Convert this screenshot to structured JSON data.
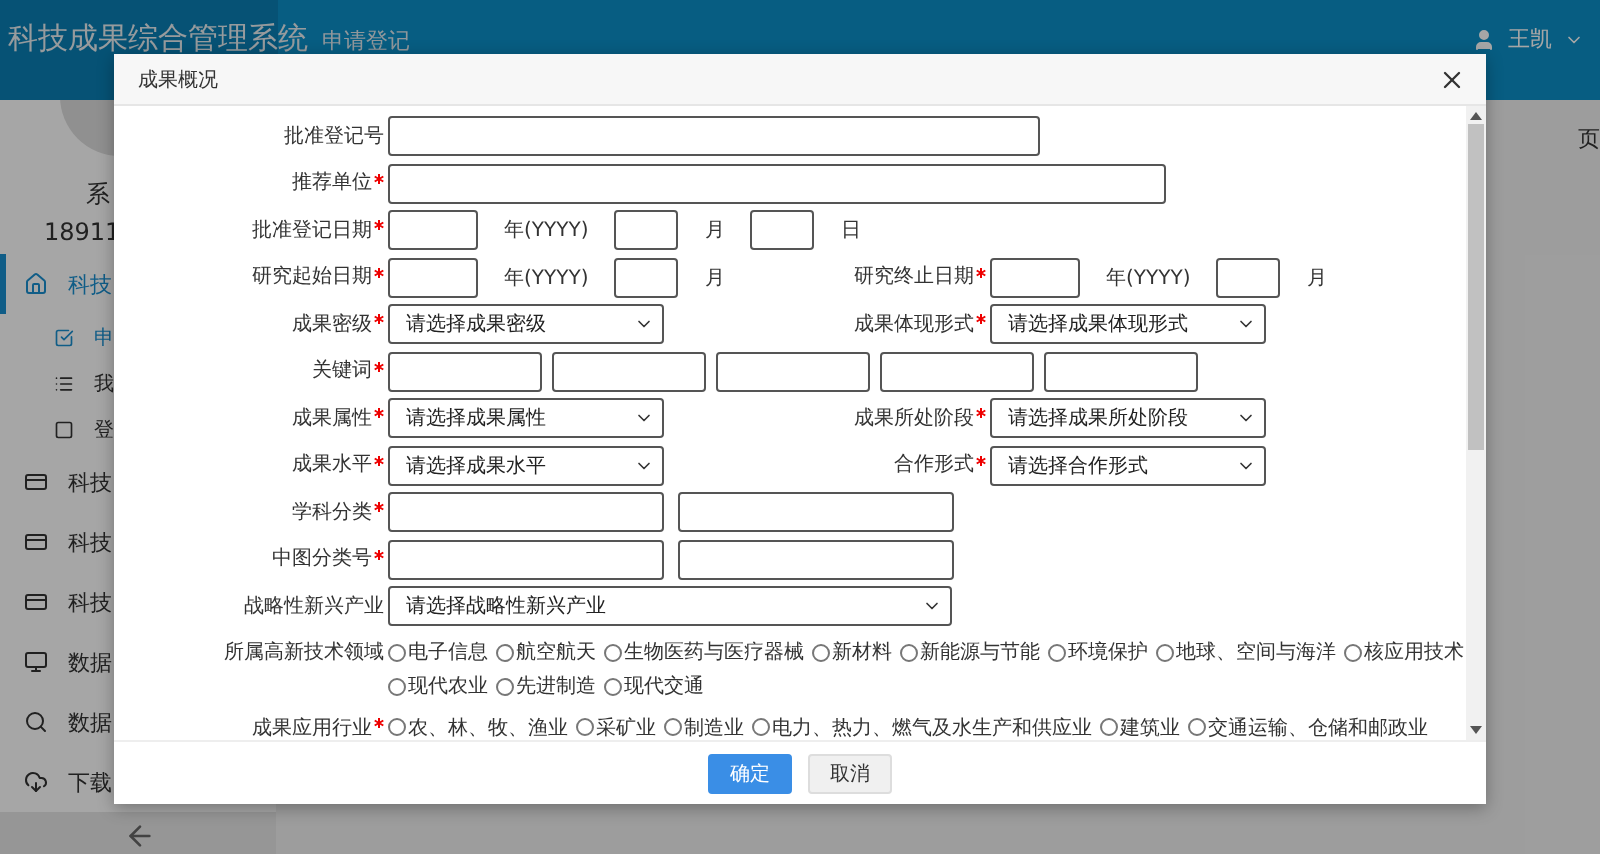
{
  "header": {
    "title": "科技成果综合管理系统",
    "nav_item": "申请登记",
    "user": "王凯"
  },
  "sidebar": {
    "user_name": "系",
    "phone": "18911",
    "items": [
      {
        "label": "科技",
        "selected": true,
        "children": [
          {
            "label": "申",
            "selected": true
          },
          {
            "label": "我",
            "selected": false
          },
          {
            "label": "登",
            "selected": false
          }
        ]
      },
      {
        "label": "科技",
        "selected": false
      },
      {
        "label": "科技",
        "selected": false
      },
      {
        "label": "科技",
        "selected": false
      },
      {
        "label": "数据",
        "selected": false
      },
      {
        "label": "数据",
        "selected": false
      },
      {
        "label": "下载",
        "selected": false
      }
    ]
  },
  "main": {
    "tab_fragment": "页"
  },
  "dialog": {
    "title": "成果概况",
    "rows": [
      {
        "cells": [
          {
            "label": "批准登记号",
            "required": false,
            "controls": [
              {
                "kind": "id-text"
              }
            ]
          }
        ]
      },
      {
        "cells": [
          {
            "label": "推荐单位",
            "required": true,
            "controls": [
              {
                "kind": "org-text"
              }
            ]
          }
        ]
      },
      {
        "cells": [
          {
            "label": "批准登记日期",
            "required": true,
            "controls": [
              {
                "kind": "year",
                "unit": "年(YYYY)"
              },
              {
                "kind": "month",
                "unit": "月"
              },
              {
                "kind": "day",
                "unit": "日"
              }
            ]
          }
        ]
      },
      {
        "cells": [
          {
            "label": "研究起始日期",
            "required": true,
            "controls": [
              {
                "kind": "year",
                "unit": "年(YYYY)"
              },
              {
                "kind": "month",
                "unit": "月"
              }
            ]
          },
          {
            "label": "研究终止日期",
            "required": true,
            "controls": [
              {
                "kind": "year",
                "unit": "年(YYYY)"
              },
              {
                "kind": "month",
                "unit": "月"
              }
            ]
          }
        ]
      },
      {
        "cells": [
          {
            "label": "成果密级",
            "required": true,
            "controls": [
              {
                "kind": "select",
                "placeholder": "请选择成果密级"
              }
            ]
          },
          {
            "label": "成果体现形式",
            "required": true,
            "controls": [
              {
                "kind": "select",
                "placeholder": "请选择成果体现形式"
              }
            ]
          }
        ]
      },
      {
        "cells": [
          {
            "label": "关键词",
            "required": true,
            "controls": [
              {
                "kind": "keyword"
              },
              {
                "kind": "keyword"
              },
              {
                "kind": "keyword"
              },
              {
                "kind": "keyword"
              },
              {
                "kind": "keyword"
              }
            ]
          }
        ]
      },
      {
        "cells": [
          {
            "label": "成果属性",
            "required": true,
            "controls": [
              {
                "kind": "select",
                "placeholder": "请选择成果属性"
              }
            ]
          },
          {
            "label": "成果所处阶段",
            "required": true,
            "controls": [
              {
                "kind": "select",
                "placeholder": "请选择成果所处阶段"
              }
            ]
          }
        ]
      },
      {
        "cells": [
          {
            "label": "成果水平",
            "required": true,
            "controls": [
              {
                "kind": "select",
                "placeholder": "请选择成果水平"
              }
            ]
          },
          {
            "label": "合作形式",
            "required": true,
            "controls": [
              {
                "kind": "select",
                "placeholder": "请选择合作形式"
              }
            ]
          }
        ]
      },
      {
        "cells": [
          {
            "label": "学科分类",
            "required": true,
            "controls": [
              {
                "kind": "code"
              },
              {
                "kind": "code"
              }
            ]
          }
        ]
      },
      {
        "cells": [
          {
            "label": "中图分类号",
            "required": true,
            "controls": [
              {
                "kind": "code"
              },
              {
                "kind": "code"
              }
            ]
          }
        ]
      },
      {
        "cells": [
          {
            "label": "战略性新兴产业",
            "required": false,
            "controls": [
              {
                "kind": "wide-select",
                "placeholder": "请选择战略性新兴产业"
              }
            ]
          }
        ]
      },
      {
        "cells": [
          {
            "label": "所属高新技术领域",
            "required": false,
            "controls": [
              {
                "kind": "radios",
                "options": [
                  {
                    "label": "电子信息",
                    "selected": false
                  },
                  {
                    "label": "航空航天",
                    "selected": false
                  },
                  {
                    "label": "生物医药与医疗器械",
                    "selected": false
                  },
                  {
                    "label": "新材料",
                    "selected": false
                  },
                  {
                    "label": "新能源与节能",
                    "selected": false
                  },
                  {
                    "label": "环境保护",
                    "selected": false
                  },
                  {
                    "label": "地球、空间与海洋",
                    "selected": false
                  },
                  {
                    "label": "核应用技术",
                    "selected": false
                  },
                  {
                    "label": "现代农业",
                    "selected": false
                  },
                  {
                    "label": "先进制造",
                    "selected": false
                  },
                  {
                    "label": "现代交通",
                    "selected": false
                  }
                ]
              }
            ]
          }
        ]
      },
      {
        "cells": [
          {
            "label": "成果应用行业",
            "required": true,
            "controls": [
              {
                "kind": "radios",
                "options": [
                  {
                    "label": "农、林、牧、渔业",
                    "selected": false
                  },
                  {
                    "label": "采矿业",
                    "selected": false
                  },
                  {
                    "label": "制造业",
                    "selected": false
                  },
                  {
                    "label": "电力、热力、燃气及水生产和供应业",
                    "selected": false
                  },
                  {
                    "label": "建筑业",
                    "selected": false
                  },
                  {
                    "label": "交通运输、仓储和邮政业",
                    "selected": false
                  }
                ]
              }
            ]
          }
        ]
      }
    ],
    "buttons": [
      {
        "label": "确定",
        "kind": "primary"
      },
      {
        "label": "取消",
        "kind": "default"
      }
    ]
  }
}
